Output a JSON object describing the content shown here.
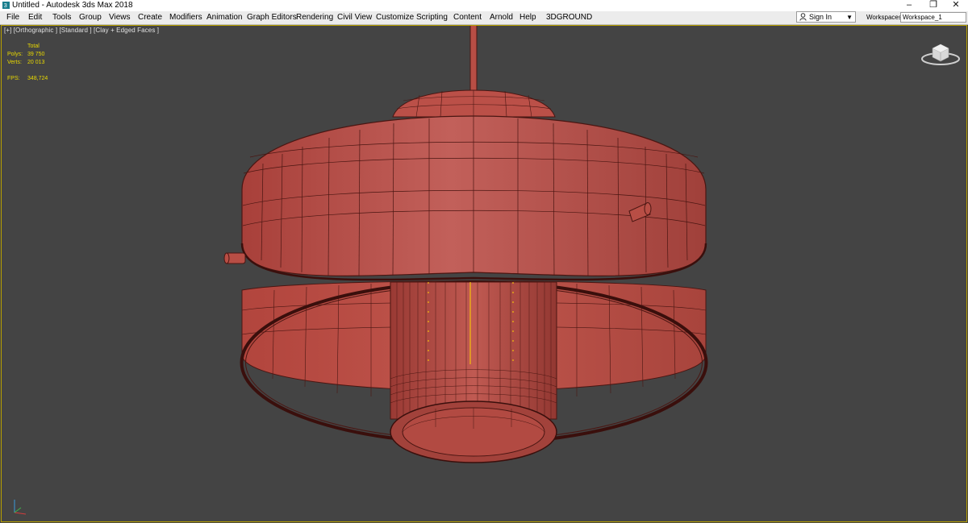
{
  "window": {
    "title": "Untitled - Autodesk 3ds Max 2018"
  },
  "menu": [
    "File",
    "Edit",
    "Tools",
    "Group",
    "Views",
    "Create",
    "Modifiers",
    "Animation",
    "Graph Editors",
    "Rendering",
    "Civil View",
    "Customize",
    "Scripting",
    "Content",
    "Arnold",
    "Help",
    "3DGROUND"
  ],
  "account": {
    "sign_in": "Sign In"
  },
  "workspace": {
    "label": "Workspaces:",
    "value": "Workspace_1"
  },
  "viewport": {
    "label": "[+] [Orthographic ] [Standard ] [Clay + Edged Faces ]",
    "stats": {
      "header": "Total",
      "polys_label": "Polys:",
      "polys_value": "39 750",
      "verts_label": "Verts:",
      "verts_value": "20 013",
      "fps_label": "FPS:",
      "fps_value": "348,724"
    },
    "colors": {
      "background": "#444444",
      "clay": "#b84e45",
      "wire": "#4a1612",
      "highlight": "#ffd400",
      "active_border": "#b8a000"
    }
  },
  "icons": {
    "app": "3dsmax-logo-icon",
    "viewcube": "viewcube-icon",
    "axis": "axis-tripod-icon"
  }
}
